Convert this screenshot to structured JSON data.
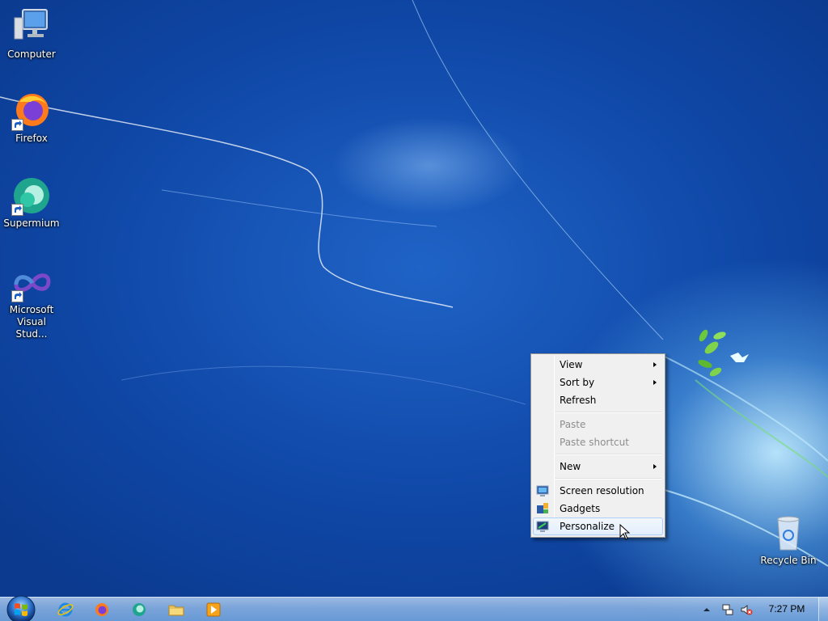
{
  "desktop": {
    "icons": [
      {
        "label": "Computer",
        "icon": "computer-icon"
      },
      {
        "label": "Firefox",
        "icon": "firefox-icon"
      },
      {
        "label": "Supermium",
        "icon": "supermium-icon"
      },
      {
        "label": "Microsoft Visual Stud...",
        "icon": "visual-studio-icon"
      },
      {
        "label": "Recycle Bin",
        "icon": "recycle-bin-icon"
      }
    ]
  },
  "context_menu": {
    "items": [
      {
        "label": "View",
        "submenu": true,
        "enabled": true
      },
      {
        "label": "Sort by",
        "submenu": true,
        "enabled": true
      },
      {
        "label": "Refresh",
        "enabled": true
      },
      {
        "label": "Paste",
        "enabled": false
      },
      {
        "label": "Paste shortcut",
        "enabled": false
      },
      {
        "label": "New",
        "submenu": true,
        "enabled": true
      },
      {
        "label": "Screen resolution",
        "icon": "display-icon",
        "enabled": true
      },
      {
        "label": "Gadgets",
        "icon": "gadgets-icon",
        "enabled": true
      },
      {
        "label": "Personalize",
        "icon": "personalize-icon",
        "enabled": true,
        "highlighted": true
      }
    ]
  },
  "taskbar": {
    "pinned": [
      "internet-explorer-icon",
      "firefox-icon",
      "supermium-icon",
      "file-explorer-icon",
      "media-player-icon"
    ],
    "tray": {
      "icons": [
        "show-hidden-icons-icon",
        "network-icon",
        "volume-muted-icon"
      ],
      "time": "7:27 PM"
    }
  },
  "colors": {
    "wallpaper": "#1a5cbf",
    "menu_bg": "#f0f0f0",
    "menu_highlight_border": "#aecff7"
  }
}
